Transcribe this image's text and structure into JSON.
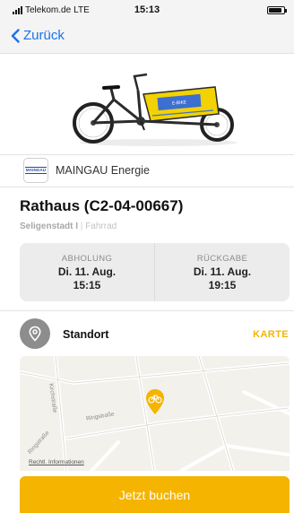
{
  "status_bar": {
    "carrier": "Telekom.de",
    "network": "LTE",
    "time": "15:13",
    "battery_level": 0.9
  },
  "nav": {
    "back_label": "Zurück"
  },
  "provider": {
    "logo_text": "MAINGAU",
    "name": "MAINGAU Energie"
  },
  "station": {
    "title": "Rathaus (C2-04-00667)",
    "city": "Seligenstadt I",
    "separator": "|",
    "type": "Fahrrad"
  },
  "booking": {
    "pickup": {
      "label": "ABHOLUNG",
      "date": "Di. 11. Aug.",
      "time": "15:15"
    },
    "return": {
      "label": "RÜCKGABE",
      "date": "Di. 11. Aug.",
      "time": "19:15"
    }
  },
  "location": {
    "label": "Standort",
    "map_link": "KARTE"
  },
  "map": {
    "streets": [
      "Kirchstraße",
      "Ringstraße",
      "Ringstraße"
    ],
    "legal_link": "Rechtl. Informationen"
  },
  "cta": {
    "label": "Jetzt buchen"
  },
  "colors": {
    "accent": "#f4b400",
    "link": "#1a73e8",
    "location_icon_bg": "#8d8d8d"
  },
  "icons": {
    "back": "chevron-left-icon",
    "location": "location-pin-icon",
    "map_pin": "bicycle-marker-icon",
    "battery": "battery-icon",
    "signal": "signal-strength-icon"
  }
}
